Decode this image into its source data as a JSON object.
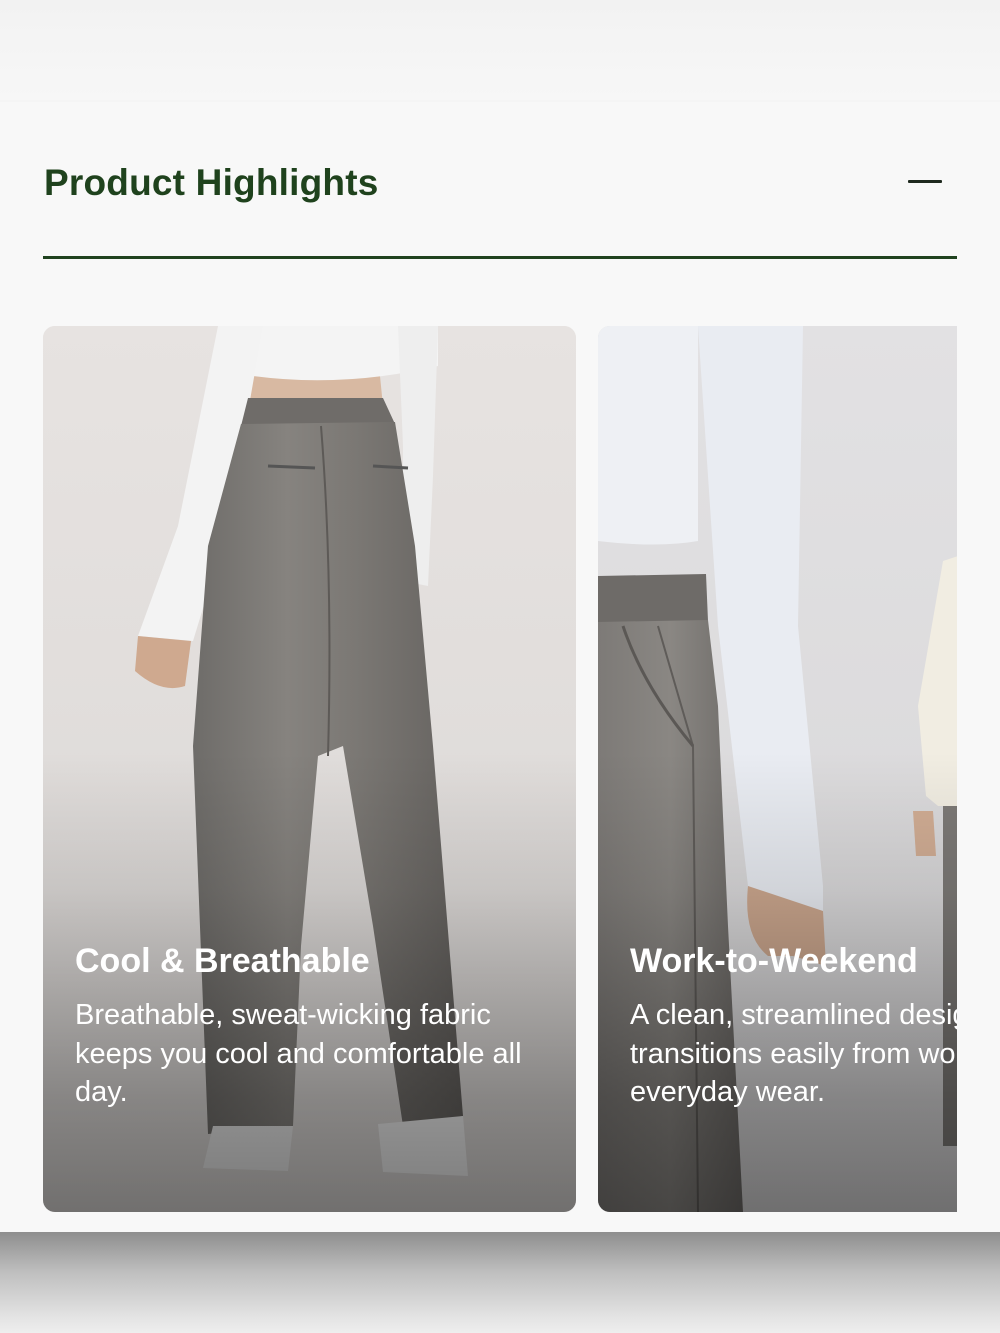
{
  "section": {
    "title": "Product Highlights",
    "toggle_icon": "minus-icon",
    "divider_color": "#20421f",
    "title_color": "#1f421d"
  },
  "highlights": [
    {
      "title": "Cool & Breathable",
      "description": "Breathable, sweat-wicking fabric keeps you cool and comfortable all day.",
      "image": "model-back-view-grey-wide-leg-pants"
    },
    {
      "title": "Work-to-Weekend",
      "description": "A clean, streamlined design transitions easily from work to everyday wear.",
      "image": "model-side-view-grey-pants-pocket"
    }
  ]
}
